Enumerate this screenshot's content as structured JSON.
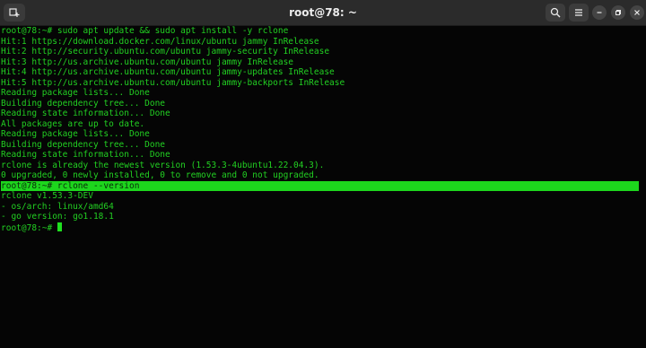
{
  "window": {
    "title": "root@78: ~"
  },
  "terminal": {
    "lines": [
      "root@78:~# sudo apt update && sudo apt install -y rclone",
      "Hit:1 https://download.docker.com/linux/ubuntu jammy InRelease",
      "Hit:2 http://security.ubuntu.com/ubuntu jammy-security InRelease",
      "Hit:3 http://us.archive.ubuntu.com/ubuntu jammy InRelease",
      "Hit:4 http://us.archive.ubuntu.com/ubuntu jammy-updates InRelease",
      "Hit:5 http://us.archive.ubuntu.com/ubuntu jammy-backports InRelease",
      "Reading package lists... Done",
      "Building dependency tree... Done",
      "Reading state information... Done",
      "All packages are up to date.",
      "Reading package lists... Done",
      "Building dependency tree... Done",
      "Reading state information... Done",
      "rclone is already the newest version (1.53.3-4ubuntu1.22.04.3).",
      "0 upgraded, 0 newly installed, 0 to remove and 0 not upgraded.",
      "root@78:~# rclone --version",
      "rclone v1.53.3-DEV",
      "- os/arch: linux/amd64",
      "- go version: go1.18.1",
      "root@78:~# "
    ],
    "highlighted_line": 15,
    "cursor_line": 19
  },
  "colors": {
    "text": "#22d022",
    "background": "#050505",
    "highlight": "#1dd61d"
  },
  "icons": {
    "new_tab": "new-tab-icon",
    "search": "search-icon",
    "menu": "hamburger-menu-icon",
    "minimize": "minimize-icon",
    "maximize": "maximize-icon",
    "close": "close-icon"
  }
}
